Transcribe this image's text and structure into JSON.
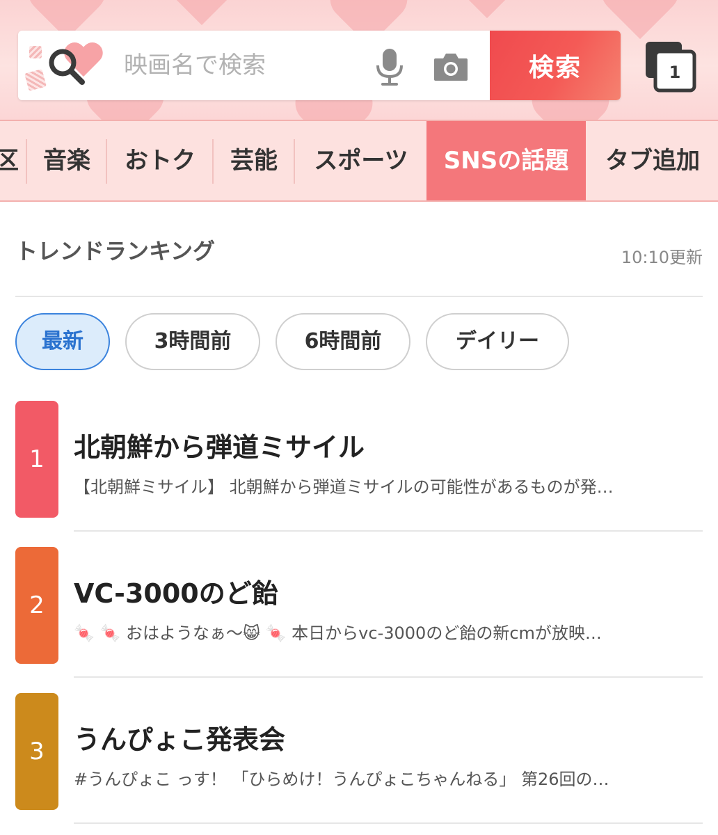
{
  "search": {
    "placeholder": "映画名で検索",
    "button_label": "検索",
    "tab_count": "1"
  },
  "category_tabs": [
    {
      "label": "区"
    },
    {
      "label": "音楽"
    },
    {
      "label": "おトク"
    },
    {
      "label": "芸能"
    },
    {
      "label": "スポーツ"
    },
    {
      "label": "SNSの話題",
      "active": true
    },
    {
      "label": "タブ追加"
    }
  ],
  "trend": {
    "title": "トレンドランキング",
    "updated": "10:10更新",
    "filters": [
      {
        "label": "最新",
        "active": true
      },
      {
        "label": "3時間前"
      },
      {
        "label": "6時間前"
      },
      {
        "label": "デイリー"
      }
    ],
    "items": [
      {
        "rank": "1",
        "color": "#f25a66",
        "title": "北朝鮮から弾道ミサイル",
        "desc": "【北朝鮮ミサイル】 北朝鮮から弾道ミサイルの可能性があるものが発…"
      },
      {
        "rank": "2",
        "color": "#ec6a38",
        "title": "VC-3000のど飴",
        "desc": "🍬 🍬 おはようなぁ〜😸 🍬 本日からvc-3000のど飴の新cmが放映…"
      },
      {
        "rank": "3",
        "color": "#cc8a1c",
        "title": "うんぴょこ発表会",
        "desc": "#うんぴょこ っす！ 「ひらめけ！うんぴょこちゃんねる」 第26回の…"
      }
    ]
  },
  "colors": {
    "accent_red": "#f04a4e",
    "tab_active": "#f4777b",
    "filter_active_border": "#3b83dd"
  }
}
